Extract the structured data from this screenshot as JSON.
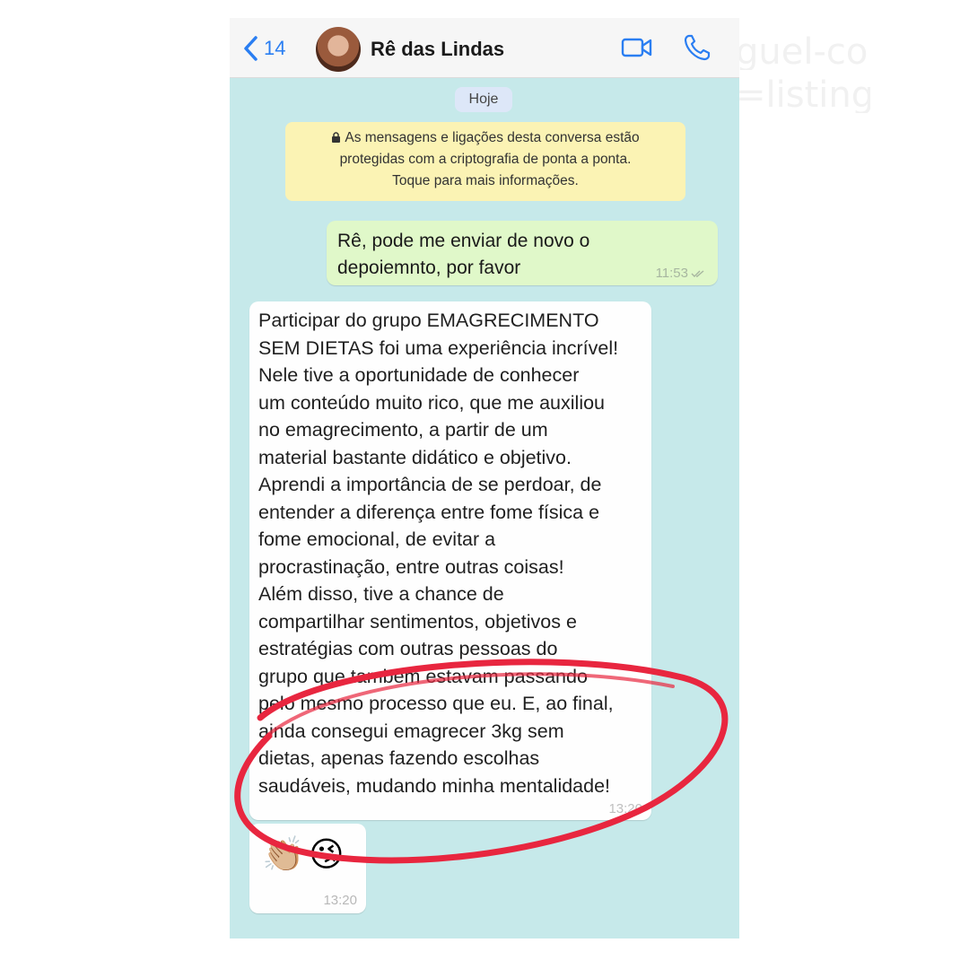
{
  "background_text": [
    "guel-co",
    "=listing_"
  ],
  "header": {
    "back_count": "14",
    "contact_name": "Rê das Lindas",
    "accent_color": "#2a7ef2",
    "icons": [
      "chevron-left-icon",
      "video-camera-icon",
      "phone-icon"
    ]
  },
  "chat": {
    "date_chip": "Hoje",
    "encryption_notice": [
      "As mensagens e ligações desta conversa estão",
      "protegidas com a criptografia de ponta a ponta.",
      "Toque para mais informações."
    ],
    "messages": [
      {
        "direction": "outgoing",
        "lines": [
          "Rê, pode me enviar de novo o",
          "depoiemnto, por favor"
        ],
        "time": "11:53",
        "status": "read"
      },
      {
        "direction": "incoming",
        "lines": [
          "Participar do grupo EMAGRECIMENTO",
          "SEM DIETAS foi uma experiência incrível!",
          "Nele tive a oportunidade de conhecer",
          "um conteúdo muito rico, que me auxiliou",
          "no emagrecimento, a partir de um",
          "material bastante didático e objetivo.",
          "Aprendi a importância de se perdoar, de",
          "entender a diferença entre fome física e",
          "fome emocional, de evitar a",
          "procrastinação, entre outras coisas!",
          "Além disso, tive a chance de",
          "compartilhar sentimentos, objetivos e",
          "estratégias com outras pessoas do",
          "grupo que também estavam passando",
          "pelo mesmo processo que eu. E, ao final,",
          "ainda consegui emagrecer 3kg sem",
          "dietas, apenas fazendo escolhas",
          "saudáveis, mudando minha mentalidade!"
        ],
        "time": "13:20"
      },
      {
        "direction": "incoming",
        "emojis": [
          "👏🏼",
          "😘"
        ],
        "time": "13:20"
      }
    ]
  },
  "colors": {
    "chat_background": "#c6e9ea",
    "outgoing_bubble": "#e0f8c9",
    "incoming_bubble": "#fefefe",
    "encryption_notice_bg": "#fbf3b4",
    "highlight_circle": "#e8263f"
  }
}
